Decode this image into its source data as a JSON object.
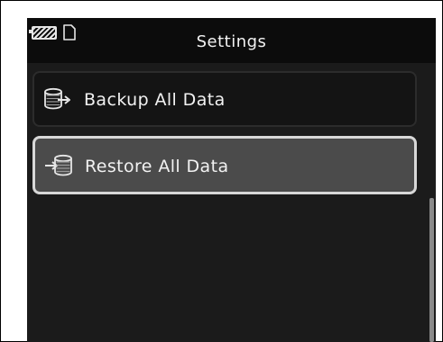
{
  "header": {
    "title": "Settings",
    "battery_icon": "battery-icon",
    "memory_card_icon": "memory-card-icon"
  },
  "menu": {
    "items": [
      {
        "label": "Backup All Data",
        "icon": "backup-database-icon",
        "selected": false
      },
      {
        "label": "Restore All Data",
        "icon": "restore-database-icon",
        "selected": true
      }
    ]
  },
  "colors": {
    "screen_bg": "#1b1b1b",
    "selected_bg": "#4b4b4b",
    "selected_border": "#d8d8d8",
    "text": "#f2f2f2"
  }
}
